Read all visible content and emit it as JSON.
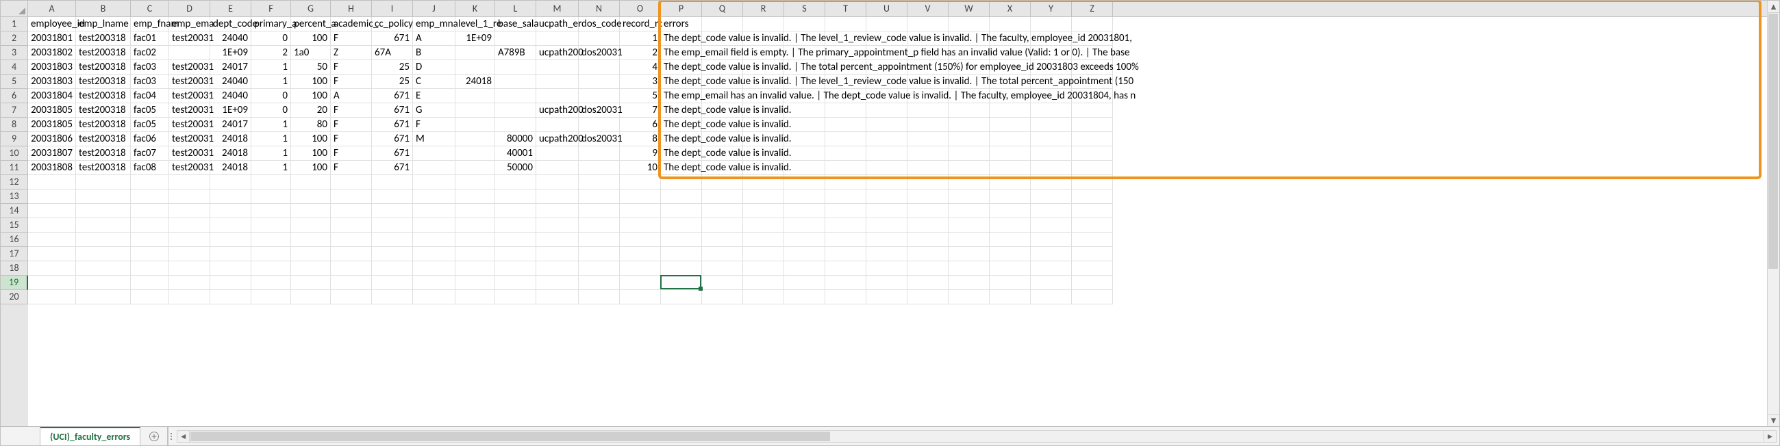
{
  "sheet_tab": "(UCI)_faculty_errors",
  "columns": [
    {
      "letter": "A",
      "width": 70,
      "header": "employee_id"
    },
    {
      "letter": "B",
      "width": 80,
      "header": "emp_lname"
    },
    {
      "letter": "C",
      "width": 56,
      "header": "emp_fnam"
    },
    {
      "letter": "D",
      "width": 60,
      "header": "emp_ema"
    },
    {
      "letter": "E",
      "width": 60,
      "header": "dept_code"
    },
    {
      "letter": "F",
      "width": 58,
      "header": "primary_a"
    },
    {
      "letter": "G",
      "width": 58,
      "header": "percent_a"
    },
    {
      "letter": "H",
      "width": 60,
      "header": "academic_"
    },
    {
      "letter": "I",
      "width": 60,
      "header": "cc_policy"
    },
    {
      "letter": "J",
      "width": 62,
      "header": "emp_mna"
    },
    {
      "letter": "K",
      "width": 58,
      "header": "level_1_re"
    },
    {
      "letter": "L",
      "width": 60,
      "header": "base_sala"
    },
    {
      "letter": "M",
      "width": 62,
      "header": "ucpath_er"
    },
    {
      "letter": "N",
      "width": 60,
      "header": "dos_code"
    },
    {
      "letter": "O",
      "width": 60,
      "header": "record_rc"
    },
    {
      "letter": "P",
      "width": 60,
      "header": "errors"
    },
    {
      "letter": "Q",
      "width": 60,
      "header": ""
    },
    {
      "letter": "R",
      "width": 60,
      "header": ""
    },
    {
      "letter": "S",
      "width": 60,
      "header": ""
    },
    {
      "letter": "T",
      "width": 60,
      "header": ""
    },
    {
      "letter": "U",
      "width": 60,
      "header": ""
    },
    {
      "letter": "V",
      "width": 60,
      "header": ""
    },
    {
      "letter": "W",
      "width": 60,
      "header": ""
    },
    {
      "letter": "X",
      "width": 60,
      "header": ""
    },
    {
      "letter": "Y",
      "width": 60,
      "header": ""
    },
    {
      "letter": "Z",
      "width": 60,
      "header": ""
    }
  ],
  "rows": [
    {
      "n": 1,
      "cells": [
        "employee_id",
        "emp_lname",
        "emp_fnam",
        "emp_ema",
        "dept_code",
        "primary_a",
        "percent_a",
        "academic_",
        "cc_policy",
        "emp_mna",
        "level_1_re",
        "base_sala",
        "ucpath_er",
        "dos_code",
        "record_rc",
        "errors",
        "",
        "",
        "",
        "",
        "",
        "",
        "",
        "",
        "",
        ""
      ],
      "types": [
        "t",
        "t",
        "t",
        "t",
        "t",
        "t",
        "t",
        "t",
        "t",
        "t",
        "t",
        "t",
        "t",
        "t",
        "t",
        "t",
        "t",
        "t",
        "t",
        "t",
        "t",
        "t",
        "t",
        "t",
        "t",
        "t"
      ]
    },
    {
      "n": 2,
      "cells": [
        "20031801",
        "test200318",
        "fac01",
        "test20031",
        "24040",
        "0",
        "100",
        "F",
        "671",
        "A",
        "1E+09",
        "",
        "",
        "",
        "1",
        "The dept_code value is invalid. | The level_1_review_code value is invalid. | The faculty, employee_id 20031801,",
        "",
        "",
        "",
        "",
        "",
        "",
        "",
        "",
        "",
        ""
      ],
      "types": [
        "n",
        "t",
        "t",
        "t",
        "n",
        "n",
        "n",
        "t",
        "n",
        "t",
        "n",
        "t",
        "t",
        "t",
        "n",
        "t",
        "t",
        "t",
        "t",
        "t",
        "t",
        "t",
        "t",
        "t",
        "t",
        "t"
      ]
    },
    {
      "n": 3,
      "cells": [
        "20031802",
        "test200318",
        "fac02",
        "",
        "1E+09",
        "2",
        "1a0",
        "Z",
        "67A",
        "B",
        "",
        "A789B",
        "ucpath200",
        "dos20031",
        "2",
        "The emp_email field is empty.  | The primary_appointment_p field has an invalid value (Valid: 1 or 0). | The base",
        "",
        "",
        "",
        "",
        "",
        "",
        "",
        "",
        "",
        ""
      ],
      "types": [
        "n",
        "t",
        "t",
        "t",
        "n",
        "n",
        "t",
        "t",
        "t",
        "t",
        "t",
        "t",
        "t",
        "t",
        "n",
        "t",
        "t",
        "t",
        "t",
        "t",
        "t",
        "t",
        "t",
        "t",
        "t",
        "t"
      ]
    },
    {
      "n": 4,
      "cells": [
        "20031803",
        "test200318",
        "fac03",
        "test20031",
        "24017",
        "1",
        "50",
        "F",
        "25",
        "D",
        "",
        "",
        "",
        "",
        "4",
        "The dept_code value is invalid. | The total percent_appointment (150%) for employee_id 20031803 exceeds 100%",
        "",
        "",
        "",
        "",
        "",
        "",
        "",
        "",
        "",
        ""
      ],
      "types": [
        "n",
        "t",
        "t",
        "t",
        "n",
        "n",
        "n",
        "t",
        "n",
        "t",
        "t",
        "t",
        "t",
        "t",
        "n",
        "t",
        "t",
        "t",
        "t",
        "t",
        "t",
        "t",
        "t",
        "t",
        "t",
        "t"
      ]
    },
    {
      "n": 5,
      "cells": [
        "20031803",
        "test200318",
        "fac03",
        "test20031",
        "24040",
        "1",
        "100",
        "F",
        "25",
        "C",
        "24018",
        "",
        "",
        "",
        "3",
        "The dept_code value is invalid. | The level_1_review_code value is invalid. | The total percent_appointment (150",
        "",
        "",
        "",
        "",
        "",
        "",
        "",
        "",
        "",
        ""
      ],
      "types": [
        "n",
        "t",
        "t",
        "t",
        "n",
        "n",
        "n",
        "t",
        "n",
        "t",
        "n",
        "t",
        "t",
        "t",
        "n",
        "t",
        "t",
        "t",
        "t",
        "t",
        "t",
        "t",
        "t",
        "t",
        "t",
        "t"
      ]
    },
    {
      "n": 6,
      "cells": [
        "20031804",
        "test200318",
        "fac04",
        "test20031",
        "24040",
        "0",
        "100",
        "A",
        "671",
        "E",
        "",
        "",
        "",
        "",
        "5",
        "The emp_email has an invalid value. | The dept_code value is invalid. | The faculty, employee_id 20031804, has n",
        "",
        "",
        "",
        "",
        "",
        "",
        "",
        "",
        "",
        ""
      ],
      "types": [
        "n",
        "t",
        "t",
        "t",
        "n",
        "n",
        "n",
        "t",
        "n",
        "t",
        "t",
        "t",
        "t",
        "t",
        "n",
        "t",
        "t",
        "t",
        "t",
        "t",
        "t",
        "t",
        "t",
        "t",
        "t",
        "t"
      ]
    },
    {
      "n": 7,
      "cells": [
        "20031805",
        "test200318",
        "fac05",
        "test20031",
        "1E+09",
        "0",
        "20",
        "F",
        "671",
        "G",
        "",
        "",
        "ucpath200",
        "dos20031",
        "7",
        "The dept_code value is invalid.",
        "",
        "",
        "",
        "",
        "",
        "",
        "",
        "",
        "",
        ""
      ],
      "types": [
        "n",
        "t",
        "t",
        "t",
        "n",
        "n",
        "n",
        "t",
        "n",
        "t",
        "t",
        "t",
        "t",
        "t",
        "n",
        "t",
        "t",
        "t",
        "t",
        "t",
        "t",
        "t",
        "t",
        "t",
        "t",
        "t"
      ]
    },
    {
      "n": 8,
      "cells": [
        "20031805",
        "test200318",
        "fac05",
        "test20031",
        "24017",
        "1",
        "80",
        "F",
        "671",
        "F",
        "",
        "",
        "",
        "",
        "6",
        "The dept_code value is invalid.",
        "",
        "",
        "",
        "",
        "",
        "",
        "",
        "",
        "",
        ""
      ],
      "types": [
        "n",
        "t",
        "t",
        "t",
        "n",
        "n",
        "n",
        "t",
        "n",
        "t",
        "t",
        "t",
        "t",
        "t",
        "n",
        "t",
        "t",
        "t",
        "t",
        "t",
        "t",
        "t",
        "t",
        "t",
        "t",
        "t"
      ]
    },
    {
      "n": 9,
      "cells": [
        "20031806",
        "test200318",
        "fac06",
        "test20031",
        "24018",
        "1",
        "100",
        "F",
        "671",
        "M",
        "",
        "80000",
        "ucpath200",
        "dos20031",
        "8",
        "The dept_code value is invalid.",
        "",
        "",
        "",
        "",
        "",
        "",
        "",
        "",
        "",
        ""
      ],
      "types": [
        "n",
        "t",
        "t",
        "t",
        "n",
        "n",
        "n",
        "t",
        "n",
        "t",
        "t",
        "n",
        "t",
        "t",
        "n",
        "t",
        "t",
        "t",
        "t",
        "t",
        "t",
        "t",
        "t",
        "t",
        "t",
        "t"
      ]
    },
    {
      "n": 10,
      "cells": [
        "20031807",
        "test200318",
        "fac07",
        "test20031",
        "24018",
        "1",
        "100",
        "F",
        "671",
        "",
        "",
        "40001",
        "",
        "",
        "9",
        "The dept_code value is invalid.",
        "",
        "",
        "",
        "",
        "",
        "",
        "",
        "",
        "",
        ""
      ],
      "types": [
        "n",
        "t",
        "t",
        "t",
        "n",
        "n",
        "n",
        "t",
        "n",
        "t",
        "t",
        "n",
        "t",
        "t",
        "n",
        "t",
        "t",
        "t",
        "t",
        "t",
        "t",
        "t",
        "t",
        "t",
        "t",
        "t"
      ]
    },
    {
      "n": 11,
      "cells": [
        "20031808",
        "test200318",
        "fac08",
        "test20031",
        "24018",
        "1",
        "100",
        "F",
        "671",
        "",
        "",
        "50000",
        "",
        "",
        "10",
        "The dept_code value is invalid.",
        "",
        "",
        "",
        "",
        "",
        "",
        "",
        "",
        "",
        ""
      ],
      "types": [
        "n",
        "t",
        "t",
        "t",
        "n",
        "n",
        "n",
        "t",
        "n",
        "t",
        "t",
        "n",
        "t",
        "t",
        "n",
        "t",
        "t",
        "t",
        "t",
        "t",
        "t",
        "t",
        "t",
        "t",
        "t",
        "t"
      ]
    },
    {
      "n": 12,
      "cells": [
        "",
        "",
        "",
        "",
        "",
        "",
        "",
        "",
        "",
        "",
        "",
        "",
        "",
        "",
        "",
        "",
        "",
        "",
        "",
        "",
        "",
        "",
        "",
        "",
        "",
        ""
      ],
      "types": []
    },
    {
      "n": 13,
      "cells": [
        "",
        "",
        "",
        "",
        "",
        "",
        "",
        "",
        "",
        "",
        "",
        "",
        "",
        "",
        "",
        "",
        "",
        "",
        "",
        "",
        "",
        "",
        "",
        "",
        "",
        ""
      ],
      "types": []
    },
    {
      "n": 14,
      "cells": [
        "",
        "",
        "",
        "",
        "",
        "",
        "",
        "",
        "",
        "",
        "",
        "",
        "",
        "",
        "",
        "",
        "",
        "",
        "",
        "",
        "",
        "",
        "",
        "",
        "",
        ""
      ],
      "types": []
    },
    {
      "n": 15,
      "cells": [
        "",
        "",
        "",
        "",
        "",
        "",
        "",
        "",
        "",
        "",
        "",
        "",
        "",
        "",
        "",
        "",
        "",
        "",
        "",
        "",
        "",
        "",
        "",
        "",
        "",
        ""
      ],
      "types": []
    },
    {
      "n": 16,
      "cells": [
        "",
        "",
        "",
        "",
        "",
        "",
        "",
        "",
        "",
        "",
        "",
        "",
        "",
        "",
        "",
        "",
        "",
        "",
        "",
        "",
        "",
        "",
        "",
        "",
        "",
        ""
      ],
      "types": []
    },
    {
      "n": 17,
      "cells": [
        "",
        "",
        "",
        "",
        "",
        "",
        "",
        "",
        "",
        "",
        "",
        "",
        "",
        "",
        "",
        "",
        "",
        "",
        "",
        "",
        "",
        "",
        "",
        "",
        "",
        ""
      ],
      "types": []
    },
    {
      "n": 18,
      "cells": [
        "",
        "",
        "",
        "",
        "",
        "",
        "",
        "",
        "",
        "",
        "",
        "",
        "",
        "",
        "",
        "",
        "",
        "",
        "",
        "",
        "",
        "",
        "",
        "",
        "",
        ""
      ],
      "types": []
    },
    {
      "n": 19,
      "cells": [
        "",
        "",
        "",
        "",
        "",
        "",
        "",
        "",
        "",
        "",
        "",
        "",
        "",
        "",
        "",
        "",
        "",
        "",
        "",
        "",
        "",
        "",
        "",
        "",
        "",
        ""
      ],
      "types": []
    },
    {
      "n": 20,
      "cells": [
        "",
        "",
        "",
        "",
        "",
        "",
        "",
        "",
        "",
        "",
        "",
        "",
        "",
        "",
        "",
        "",
        "",
        "",
        "",
        "",
        "",
        "",
        "",
        "",
        "",
        ""
      ],
      "types": []
    }
  ],
  "selection": {
    "row": 19,
    "col": 15
  },
  "highlight": {
    "top": 0,
    "left_col": 15
  }
}
